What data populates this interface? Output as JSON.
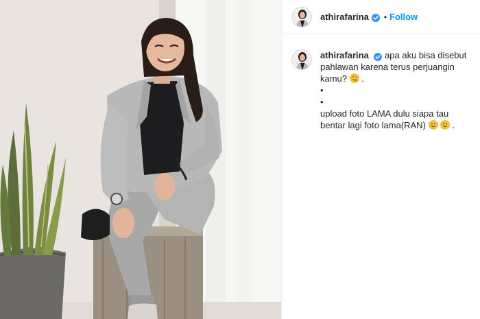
{
  "post": {
    "username": "athirafarina",
    "separator": "•",
    "follow_label": "Follow"
  },
  "caption": {
    "username": "athirafarina",
    "line1": "apa aku bisa disebut pahlawan karena terus perjuangin kamu?",
    "line1_end": ".",
    "bullet1": "•",
    "bullet2": "•",
    "line2": "upload foto LAMA dulu siapa tau bentar lagi foto lama(RAN)",
    "line2_end": "."
  },
  "icons": {
    "verified": "verified-badge-icon",
    "emoji1": "face-savoring-food-icon",
    "emoji2": "slightly-smiling-face-icon"
  },
  "colors": {
    "accent": "#0095f6",
    "verified": "#3897f0",
    "text": "#262626"
  }
}
